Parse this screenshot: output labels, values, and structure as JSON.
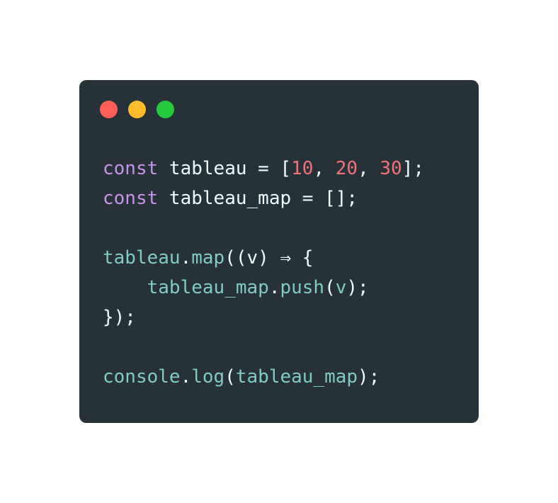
{
  "window": {
    "background": "#263238",
    "traffic_lights": [
      {
        "name": "close",
        "color": "#ff5f56"
      },
      {
        "name": "minimize",
        "color": "#ffbd2e"
      },
      {
        "name": "maximize",
        "color": "#27c93f"
      }
    ]
  },
  "code": {
    "line1": {
      "kw": "const",
      "name": " tableau = [",
      "n1": "10",
      "c1": ", ",
      "n2": "20",
      "c2": ", ",
      "n3": "30",
      "end": "];"
    },
    "line2": {
      "kw": "const",
      "rest": " tableau_map = [];"
    },
    "line4": {
      "obj": "tableau",
      "dot": ".",
      "fn": "map",
      "rest": "((v) ⇒ {"
    },
    "line5": {
      "indent": "    ",
      "obj": "tableau_map",
      "dot": ".",
      "fn": "push",
      "open": "(",
      "arg": "v",
      "close": ");"
    },
    "line6": {
      "text": "});"
    },
    "line8": {
      "obj": "console",
      "dot": ".",
      "fn": "log",
      "open": "(",
      "arg": "tableau_map",
      "close": ");"
    }
  },
  "colors": {
    "keyword": "#c792ea",
    "number": "#f07178",
    "function": "#80cbc4",
    "text": "#eeffff"
  }
}
